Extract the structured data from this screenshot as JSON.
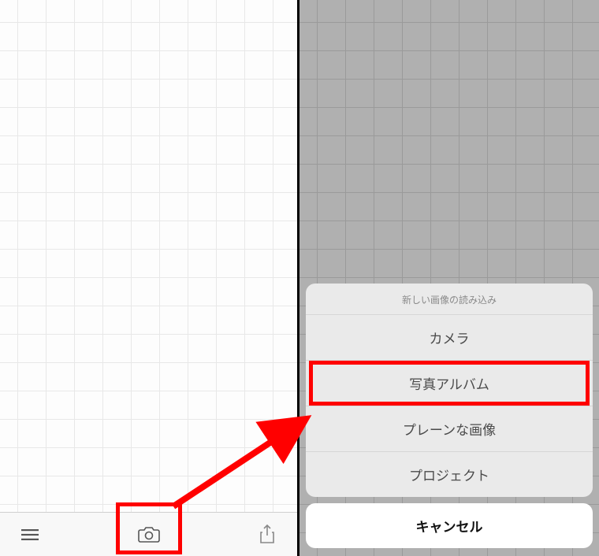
{
  "sheet": {
    "header": "新しい画像の読み込み",
    "items": {
      "camera": "カメラ",
      "album": "写真アルバム",
      "plain": "プレーンな画像",
      "project": "プロジェクト"
    },
    "cancel": "キャンセル"
  }
}
